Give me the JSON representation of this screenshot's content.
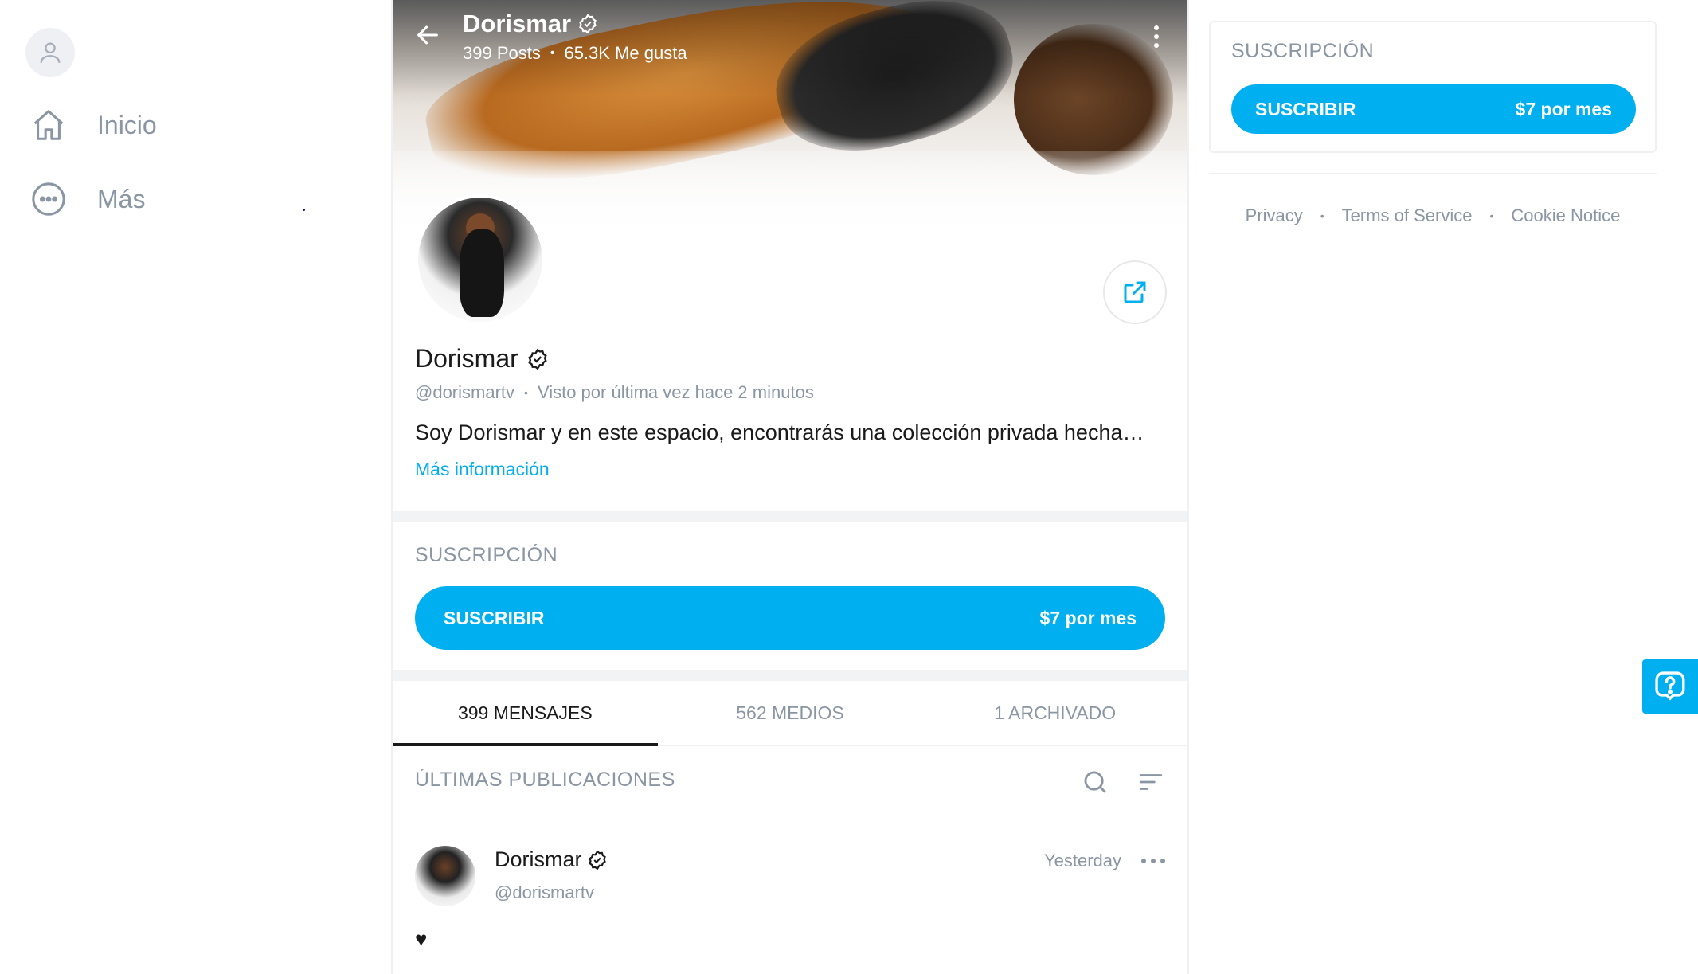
{
  "sidebar": {
    "items": [
      {
        "label": "Inicio",
        "icon": "home-icon"
      },
      {
        "label": "Más",
        "icon": "more-circle-icon"
      }
    ]
  },
  "header": {
    "title": "Dorismar",
    "posts": "399 Posts",
    "likes": "65.3K Me gusta",
    "separator": "•"
  },
  "profile": {
    "name": "Dorismar",
    "handle": "@dorismartv",
    "meta_separator": "•",
    "last_seen": "Visto por última vez hace 2 minutos",
    "bio": "Soy Dorismar y en este espacio, encontrarás una colección privada hecha…",
    "more_info": "Más información"
  },
  "subscription": {
    "title": "SUSCRIPCIÓN",
    "button_label": "SUSCRIBIR",
    "price": "$7 por mes"
  },
  "tabs": [
    {
      "label": "399 MENSAJES",
      "active": true
    },
    {
      "label": "562 MEDIOS",
      "active": false
    },
    {
      "label": "1 ARCHIVADO",
      "active": false
    }
  ],
  "feed": {
    "title": "ÚLTIMAS PUBLICACIONES"
  },
  "post": {
    "author": "Dorismar",
    "handle": "@dorismartv",
    "time": "Yesterday",
    "text": "♥"
  },
  "right": {
    "subscription_title": "SUSCRIPCIÓN",
    "button_label": "SUSCRIBIR",
    "price": "$7 por mes",
    "footer": {
      "privacy": "Privacy",
      "terms": "Terms of Service",
      "cookie": "Cookie Notice",
      "separator": "•"
    }
  },
  "colors": {
    "accent": "#00aff0",
    "muted": "#8a96a3",
    "text": "#1a1a1a"
  }
}
